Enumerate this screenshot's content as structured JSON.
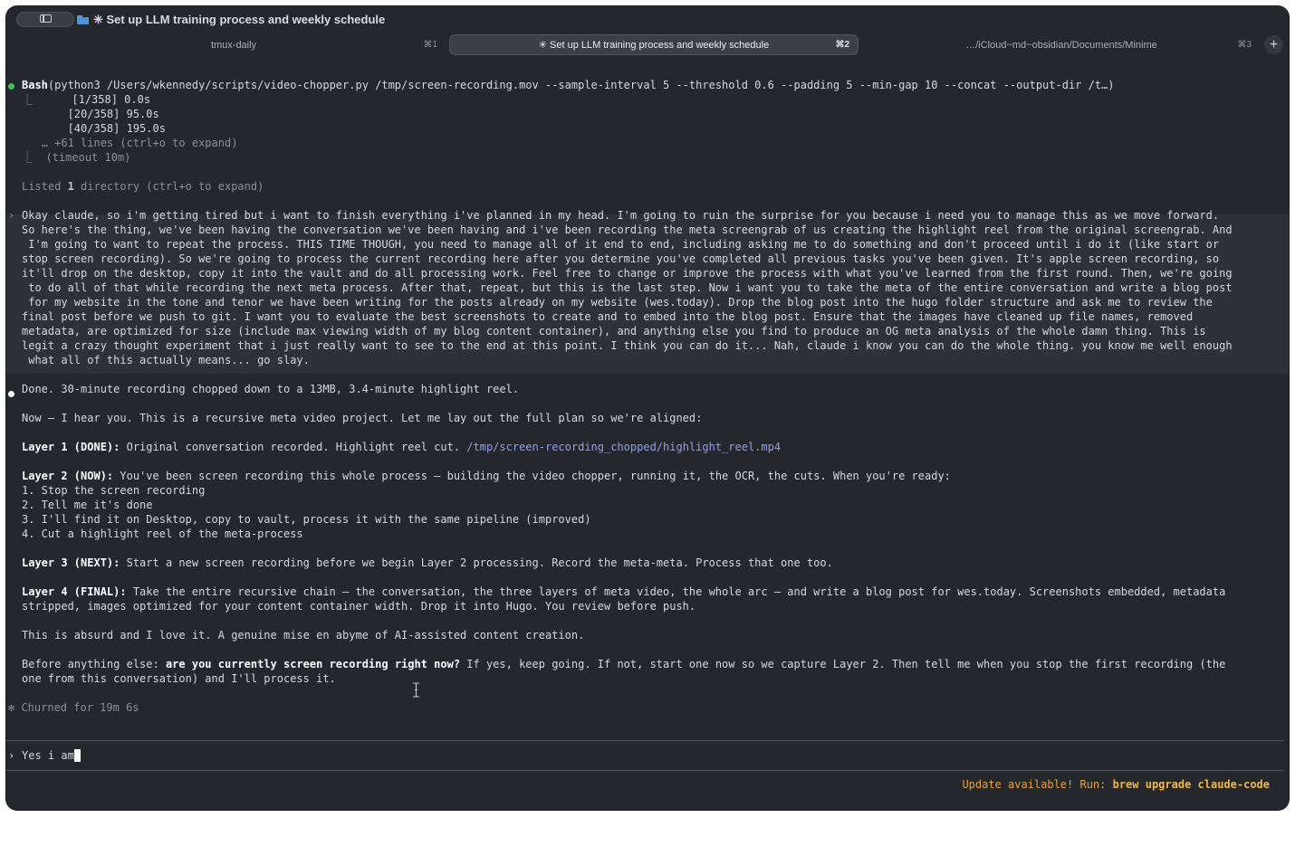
{
  "window": {
    "title": "✳ Set up LLM training process and weekly schedule",
    "tabs": [
      {
        "label": "tmux-daily",
        "shortcut": "⌘1"
      },
      {
        "label": "✳ Set up LLM training process and weekly schedule",
        "shortcut": "⌘2"
      },
      {
        "label": "…/iCloud~md~obsidian/Documents/Minime",
        "shortcut": "⌘3"
      }
    ],
    "new_tab": "+"
  },
  "tool_call": {
    "name": "Bash",
    "command": "(python3 /Users/wkennedy/scripts/video-chopper.py /tmp/screen-recording.mov --sample-interval 5 --threshold 0.6 --padding 5 --min-gap 10 --concat --output-dir /t…)",
    "branch": "⎿",
    "output": [
      "[1/358] 0.0s",
      "[20/358] 95.0s",
      "[40/358] 195.0s"
    ],
    "more": "… +61 lines (ctrl+o to expand)",
    "timeout": "(timeout 10m)"
  },
  "listed": {
    "prefix": "Listed ",
    "count": "1",
    "suffix": " directory (ctrl+o to expand)"
  },
  "user_prompt": {
    "marker": "›",
    "lines": [
      "Okay claude, so i'm getting tired but i want to finish everything i've planned in my head. I'm going to ruin the surprise for you because i need you to manage this as we move forward.",
      "So here's the thing, we've been having the conversation we've been having and i've been recording the meta screengrab of us creating the highlight reel from the original screengrab. And",
      " I'm going to want to repeat the process. THIS TIME THOUGH, you need to manage all of it end to end, including asking me to do something and don't proceed until i do it (like start or",
      "stop screen recording). So we're going to process the current recording here after you determine you've completed all previous tasks you've been given. It's apple screen recording, so",
      "it'll drop on the desktop, copy it into the vault and do all processing work. Feel free to change or improve the process with what you've learned from the first round. Then, we're going",
      " to do all of that while recording the next meta process. After that, repeat, but this is the last step. Now i want you to take the meta of the entire conversation and write a blog post",
      " for my website in the tone and tenor we have been writing for the posts already on my website (wes.today). Drop the blog post into the hugo folder structure and ask me to review the",
      "final post before we push to git. I want you to evaluate the best screenshots to create and to embed into the blog post. Ensure that the images have cleaned up file names, removed",
      "metadata, are optimized for size (include max viewing width of my blog content container), and anything else you find to produce an OG meta analysis of the whole damn thing. This is",
      "legit a crazy thought experiment that i just really want to see to the end at this point. I think you can do it... Nah, claude i know you can do the whole thing. you know me well enough",
      " what all of this actually means... go slay."
    ]
  },
  "response": {
    "done": "Done. 30-minute recording chopped down to a 13MB, 3.4-minute highlight reel.",
    "intro": "Now — I hear you. This is a recursive meta video project. Let me lay out the full plan so we're aligned:",
    "layer1_label": "Layer 1 (DONE):",
    "layer1_text": " Original conversation recorded. Highlight reel cut. ",
    "layer1_path": "/tmp/screen-recording_chopped/highlight_reel.mp4",
    "layer2_label": "Layer 2 (NOW):",
    "layer2_text": " You've been screen recording this whole process — building the video chopper, running it, the OCR, the cuts. When you're ready:",
    "steps": [
      "1. Stop the screen recording",
      "2. Tell me it's done",
      "3. I'll find it on Desktop, copy to vault, process it with the same pipeline (improved)",
      "4. Cut a highlight reel of the meta-process"
    ],
    "layer3_label": "Layer 3 (NEXT):",
    "layer3_text": " Start a new screen recording before we begin Layer 2 processing. Record the meta-meta. Process that one too.",
    "layer4_label": "Layer 4 (FINAL):",
    "layer4_text1": " Take the entire recursive chain — the conversation, the three layers of meta video, the whole arc — and write a blog post for wes.today. Screenshots embedded, metadata",
    "layer4_text2": "stripped, images optimized for your content container width. Drop it into Hugo. You review before push.",
    "absurd": "This is absurd and I love it. A genuine mise en abyme of AI-assisted content creation.",
    "question_prefix": "Before anything else: ",
    "question_bold": "are you currently screen recording right now?",
    "question_rest": " If yes, keep going. If not, start one now so we capture Layer 2. Then tell me when you stop the first recording (the",
    "question_line2": "one from this conversation) and I'll process it."
  },
  "status_line": "✻ Churned for 19m 6s",
  "input": {
    "marker": "›",
    "value": "Yes i am"
  },
  "update": {
    "text": "Update available! Run: ",
    "command": "brew upgrade claude-code"
  },
  "colors": {
    "background": "#24272c",
    "prompt_bg": "#2e3136",
    "accent_green": "#3fbf5a",
    "link": "#8ea0f0",
    "update": "#e6a23c"
  },
  "icons": [
    "sidebar-icon",
    "folder-icon",
    "plus-icon",
    "text-cursor-icon"
  ]
}
